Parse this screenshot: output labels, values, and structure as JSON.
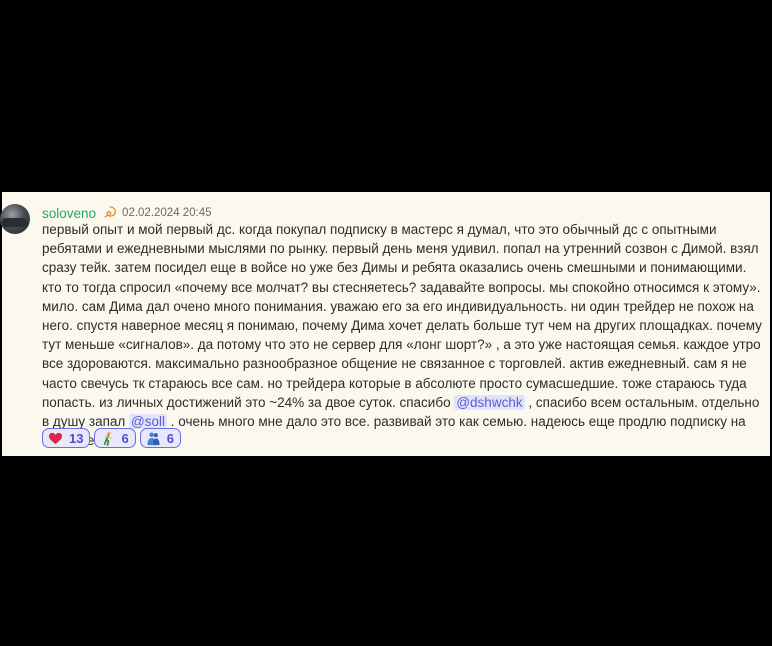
{
  "post": {
    "author": "soloveno",
    "badge_icon": "naruto-swirl-icon",
    "timestamp": "02.02.2024 20:45",
    "text": {
      "part1": "первый опыт и мой первый дс. когда покупал подписку в мастерс я думал, что это обычный дс с опытными ребятами и ежедневными мыслями по рынку. первый день меня удивил. попал на утренний созвон с Димой. взял сразу тейк. затем посидел еще в войсе но уже без Димы и ребята оказались очень смешными и понимающими. кто то тогда спросил «почему все молчат? вы стесняетесь? задавайте вопросы. мы спокойно относимся к этому». мило. сам Дима дал очено много понимания. уважаю его за его индивидуальность. ни один трейдер не похож на него. спустя наверное месяц я понимаю, почему Дима хочет делать больше тут чем на других площадках. почему тут меньше «сигналов». да потому что это не сервер для «лонг шорт?» , а это уже настоящая семья. каждое утро все здороваются. максимально разнообразное общение не связанное с торговлей. актив ежедневный. сам я не часто свечусь тк стараюсь все сам. но трейдера которые в абсолюте просто сумасшедшие. тоже стараюсь туда попасть. из личных достижений это ~24% за двое суток. спасибо ",
      "mention1": "@dshwchk",
      "part2": " , спасибо всем остальным. отдельно в душу запал ",
      "mention2": "@soll",
      "part3": " . очень много мне дало это все. развивай это как семью. надеюсь еще продлю подписку на пожизненно"
    },
    "reactions": [
      {
        "icon": "heart-icon",
        "count": "13",
        "color": "#d9264a"
      },
      {
        "icon": "person-running-icon",
        "count": "6",
        "color": "#3a8a3a"
      },
      {
        "icon": "people-hugging-icon",
        "count": "6",
        "color": "#4a7fd6"
      }
    ]
  },
  "colors": {
    "background": "#000000",
    "card": "#fbf8ee",
    "username": "#24a85a",
    "mention_bg": "#e2e2fa",
    "mention_text": "#5a5fd1",
    "reaction_border": "#6a6de0"
  }
}
